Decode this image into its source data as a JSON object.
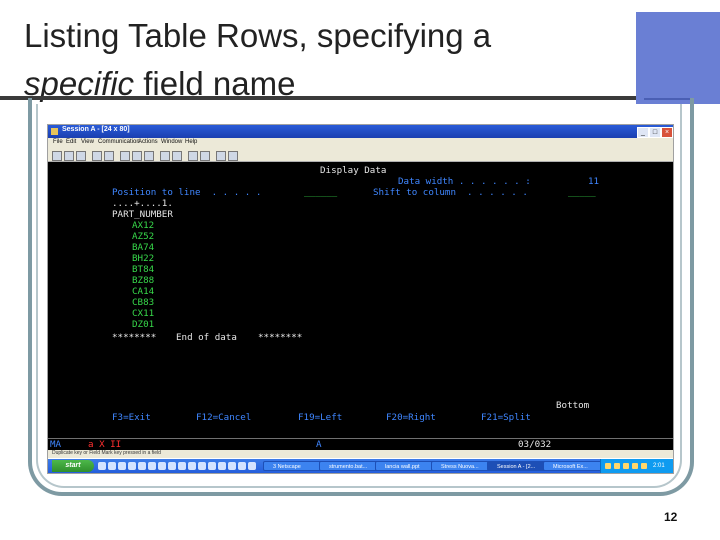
{
  "slide": {
    "title_line1": "Listing Table Rows, specifying a",
    "title_line2_em": "specific",
    "title_line2_rest": " field name",
    "page_number": "12",
    "accent_color": "#6a7fd4"
  },
  "window": {
    "title": "Session A - [24 x 80]",
    "menu": [
      "File",
      "Edit",
      "View",
      "Communication",
      "Actions",
      "Window",
      "Help"
    ],
    "buttons": {
      "minimize": "_",
      "maximize": "□",
      "close": "×"
    }
  },
  "terminal": {
    "heading": "Display Data",
    "data_width_label": "Data width . . . . . . :",
    "data_width_value": "11",
    "position_label": "Position to line  . . . . .",
    "position_value": "______",
    "shift_label": "Shift to column  . . . . . .",
    "shift_value": "_____",
    "ruler": "....+....1.",
    "column_header": "PART_NUMBER",
    "rows": [
      "AX12",
      "AZ52",
      "BA74",
      "BH22",
      "BT84",
      "BZ88",
      "CA14",
      "CB83",
      "CX11",
      "DZ01"
    ],
    "end_marker_left": "********",
    "end_of_data": "End of data",
    "end_marker_right": "********",
    "bottom": "Bottom",
    "function_keys": [
      "F3=Exit",
      "F12=Cancel",
      "F19=Left",
      "F20=Right",
      "F21=Split"
    ]
  },
  "oia": {
    "session": "MA",
    "indicator": "a X II",
    "field": "A",
    "cursor": "03/032"
  },
  "status_bar": "Duplicate key or Field Mark key pressed in a field",
  "taskbar": {
    "start": "start",
    "tasks": [
      "3 Netscape",
      "strumento.bat...",
      "lancia wall.ppt",
      "Stress Nuova...",
      "Session A - [2...",
      "Microsoft Ex..."
    ],
    "clock": "2:01 PM"
  }
}
